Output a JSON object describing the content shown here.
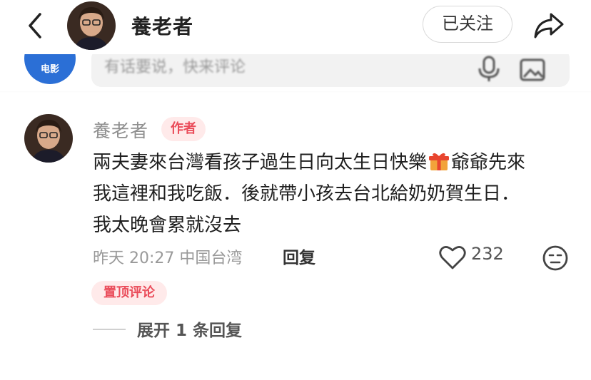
{
  "header": {
    "back_icon": "chevron-left-icon",
    "username": "養老者",
    "follow_label": "已关注",
    "share_icon": "share-arrow-icon"
  },
  "input_bar": {
    "badge_text": "电影",
    "placeholder": "有话要说，快来评论",
    "icons": [
      "mic-icon",
      "image-icon"
    ]
  },
  "comment": {
    "author": "養老者",
    "author_tag": "作者",
    "lines": [
      "兩夫妻來台灣看孩子過生日向太生日快樂",
      "爺爺先來",
      "我這裡和我吃飯．後就帶小孩去台北給奶奶賀生日．",
      "我太晚會累就沒去"
    ],
    "inline_emoji": "gift-emoji",
    "meta": "昨天 20:27 中国台湾",
    "reply_label": "回复",
    "like_count": "232",
    "pin_tag": "置顶评论",
    "expand_label": "展开 1 条回复"
  },
  "colors": {
    "accent_red": "#ea4c5a",
    "tag_bg": "#ffeaea",
    "badge_blue": "#2b6fd6",
    "muted_text": "#999999"
  }
}
